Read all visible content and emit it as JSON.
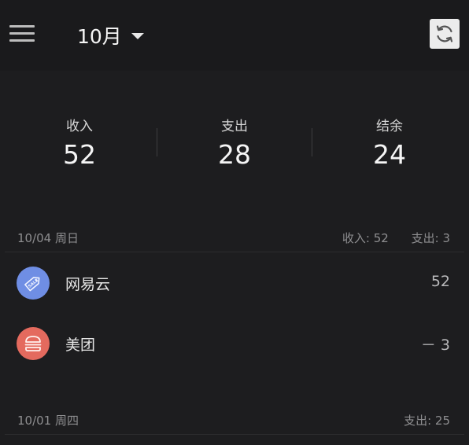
{
  "header": {
    "month_label": "10月",
    "menu_icon": "hamburger-menu-icon",
    "refresh_icon": "refresh-icon"
  },
  "summary": {
    "income_label": "收入",
    "income_value": "52",
    "expense_label": "支出",
    "expense_value": "28",
    "balance_label": "结余",
    "balance_value": "24"
  },
  "days": [
    {
      "date": "10/04 周日",
      "income_total": "收入: 52",
      "expense_total": "支出: 3",
      "items": [
        {
          "name": "网易云",
          "amount": "52",
          "icon": "sale-tag-icon",
          "icon_color": "#6f8ee4"
        },
        {
          "name": "美团",
          "amount": "－ 3",
          "icon": "burger-icon",
          "icon_color": "#e46a5e"
        }
      ]
    },
    {
      "date": "10/01 周四",
      "expense_total": "支出: 25",
      "items": []
    }
  ],
  "colors": {
    "background": "#1d1d1f",
    "appbar": "#1a1a1c",
    "text_primary": "#f5f5f5",
    "text_secondary": "#8e8e90"
  }
}
